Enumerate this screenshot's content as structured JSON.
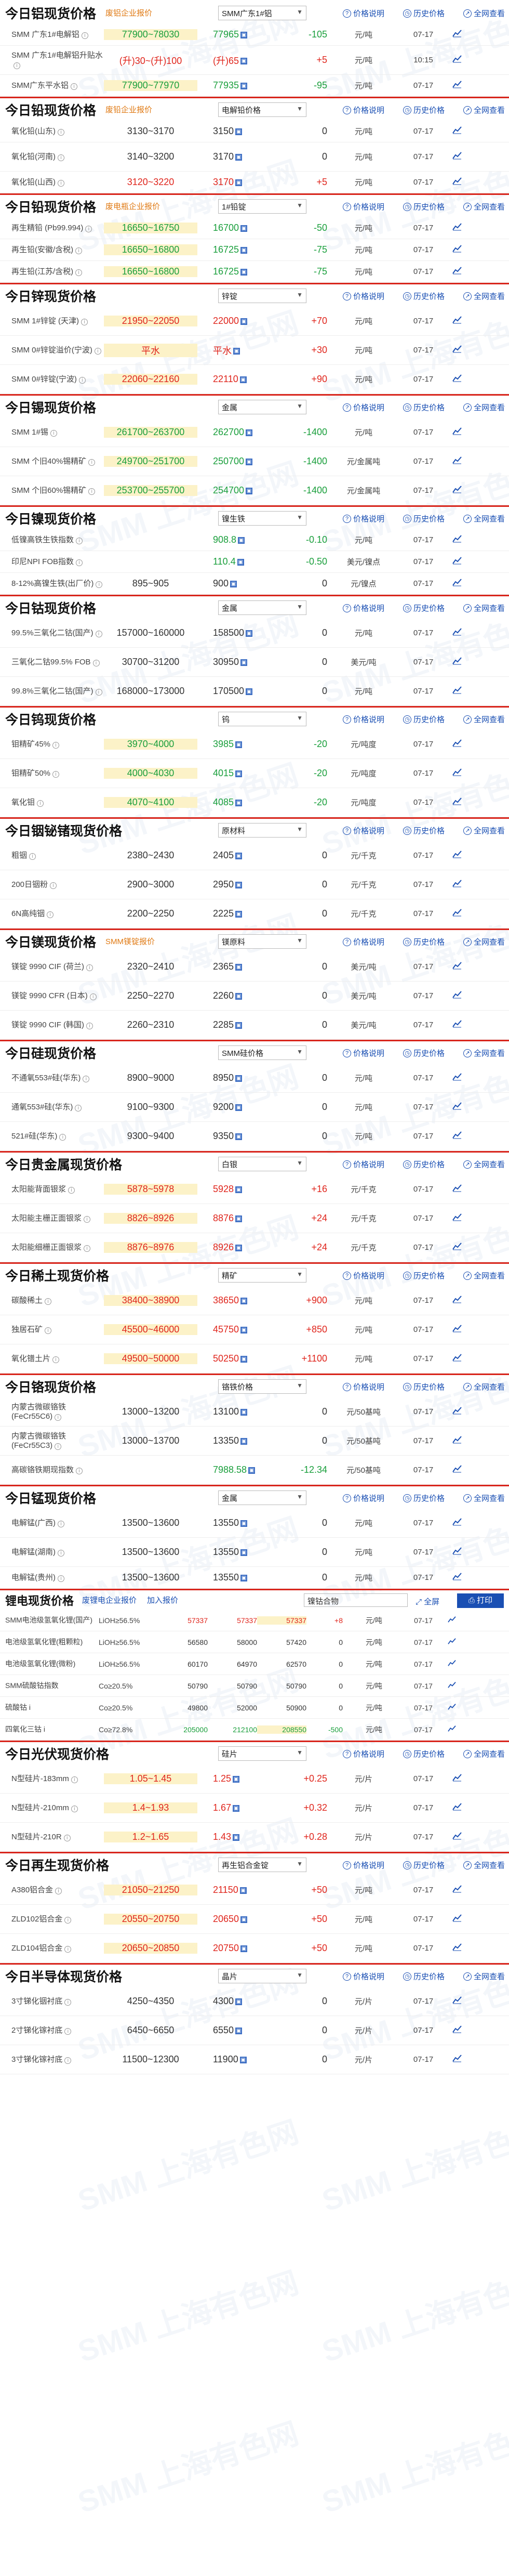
{
  "watermark": "SMM 上海有色网",
  "links": {
    "price_desc": "价格说明",
    "history": "历史价格",
    "full": "全网查看"
  },
  "chart_icon": "line-chart-icon",
  "sections": [
    {
      "title": "今日铝现货价格",
      "tag": "废铝企业报价",
      "select": "SMM广东1#铝",
      "noline": true,
      "rows": [
        {
          "name": "SMM 广东1#电解铝",
          "range": "77900~78030",
          "avg": "77965",
          "chg": "-105",
          "dir": "down",
          "unit": "元/吨",
          "date": "07-17",
          "hl": true
        },
        {
          "name": "SMM 广东1#电解铝升贴水",
          "range": "(升)30~(升)100",
          "avg": "(升)65",
          "chg": "+5",
          "dir": "up",
          "unit": "元/吨",
          "date": "10:15",
          "tall": true
        },
        {
          "name": "SMM广东平水铝",
          "range": "77900~77970",
          "avg": "77935",
          "chg": "-95",
          "dir": "down",
          "unit": "元/吨",
          "date": "07-17",
          "hl": true
        }
      ]
    },
    {
      "title": "今日铅现货价格",
      "tag": "废铅企业报价",
      "select": "电解铅价格",
      "rows": [
        {
          "name": "氧化铅(山东)",
          "range": "3130~3170",
          "avg": "3150",
          "chg": "0",
          "dir": "flat",
          "unit": "元/吨",
          "date": "07-17"
        },
        {
          "name": "氧化铅(河南)",
          "range": "3140~3200",
          "avg": "3170",
          "chg": "0",
          "dir": "flat",
          "unit": "元/吨",
          "date": "07-17",
          "tall": true
        },
        {
          "name": "氧化铅(山西)",
          "range": "3120~3220",
          "avg": "3170",
          "chg": "+5",
          "dir": "up",
          "unit": "元/吨",
          "date": "07-17"
        }
      ]
    },
    {
      "title": "今日铅现货价格",
      "tag": "废电瓶企业报价",
      "select": "1#铅锭",
      "rows": [
        {
          "name": "再生精铅 (Pb99.994)",
          "range": "16650~16750",
          "avg": "16700",
          "chg": "-50",
          "dir": "down",
          "unit": "元/吨",
          "date": "07-17",
          "hl": true
        },
        {
          "name": "再生铅(安徽/含税)",
          "range": "16650~16800",
          "avg": "16725",
          "chg": "-75",
          "dir": "down",
          "unit": "元/吨",
          "date": "07-17",
          "hl": true
        },
        {
          "name": "再生铅(江苏/含税)",
          "range": "16650~16800",
          "avg": "16725",
          "chg": "-75",
          "dir": "down",
          "unit": "元/吨",
          "date": "07-17",
          "hl": true
        }
      ]
    },
    {
      "title": "今日锌现货价格",
      "tag": "",
      "select": "锌锭",
      "rows": [
        {
          "name": "SMM 1#锌锭 (天津)",
          "range": "21950~22050",
          "avg": "22000",
          "chg": "+70",
          "dir": "up",
          "unit": "元/吨",
          "date": "07-17",
          "hl": true,
          "tall": true
        },
        {
          "name": "SMM 0#锌锭溢价(宁波)",
          "range": "平水",
          "avg": "平水",
          "chg": "+30",
          "dir": "up",
          "unit": "元/吨",
          "date": "07-17",
          "hl": true,
          "tall": true
        },
        {
          "name": "SMM 0#锌锭(宁波)",
          "range": "22060~22160",
          "avg": "22110",
          "chg": "+90",
          "dir": "up",
          "unit": "元/吨",
          "date": "07-17",
          "hl": true,
          "tall": true
        }
      ]
    },
    {
      "title": "今日锡现货价格",
      "tag": "",
      "select": "金属",
      "rows": [
        {
          "name": "SMM 1#锡",
          "range": "261700~263700",
          "avg": "262700",
          "chg": "-1400",
          "dir": "down",
          "unit": "元/吨",
          "date": "07-17",
          "hl": true,
          "tall": true
        },
        {
          "name": "SMM 个旧40%锡精矿",
          "range": "249700~251700",
          "avg": "250700",
          "chg": "-1400",
          "dir": "down",
          "unit": "元/金属吨",
          "date": "07-17",
          "hl": true,
          "tall": true
        },
        {
          "name": "SMM 个旧60%锡精矿",
          "range": "253700~255700",
          "avg": "254700",
          "chg": "-1400",
          "dir": "down",
          "unit": "元/金属吨",
          "date": "07-17",
          "hl": true,
          "tall": true
        }
      ]
    },
    {
      "title": "今日镍现货价格",
      "tag": "",
      "select": "镍生铁",
      "rows": [
        {
          "name": "低镍高铁生铁指数",
          "range": "",
          "avg": "908.8",
          "chg": "-0.10",
          "dir": "down",
          "unit": "元/吨",
          "date": "07-17"
        },
        {
          "name": "印尼NPI FOB指数",
          "range": "",
          "avg": "110.4",
          "chg": "-0.50",
          "dir": "down",
          "unit": "美元/镍点",
          "date": "07-17"
        },
        {
          "name": "8-12%高镍生铁(出厂价)",
          "range": "895~905",
          "avg": "900",
          "chg": "0",
          "dir": "flat",
          "unit": "元/镍点",
          "date": "07-17"
        }
      ]
    },
    {
      "title": "今日钴现货价格",
      "tag": "",
      "select": "金属",
      "rows": [
        {
          "name": "99.5%三氧化二钴(国产)",
          "range": "157000~160000",
          "avg": "158500",
          "chg": "0",
          "dir": "flat",
          "unit": "元/吨",
          "date": "07-17",
          "tall": true
        },
        {
          "name": "三氧化二钴99.5% FOB",
          "range": "30700~31200",
          "avg": "30950",
          "chg": "0",
          "dir": "flat",
          "unit": "美元/吨",
          "date": "07-17",
          "tall": true
        },
        {
          "name": "99.8%三氧化二钴(国产)",
          "range": "168000~173000",
          "avg": "170500",
          "chg": "0",
          "dir": "flat",
          "unit": "元/吨",
          "date": "07-17",
          "tall": true
        }
      ]
    },
    {
      "title": "今日钨现货价格",
      "tag": "",
      "select": "钨",
      "rows": [
        {
          "name": "钼精矿45%",
          "range": "3970~4000",
          "avg": "3985",
          "chg": "-20",
          "dir": "down",
          "unit": "元/吨度",
          "date": "07-17",
          "hl": true,
          "tall": true
        },
        {
          "name": "钼精矿50%",
          "range": "4000~4030",
          "avg": "4015",
          "chg": "-20",
          "dir": "down",
          "unit": "元/吨度",
          "date": "07-17",
          "hl": true,
          "tall": true
        },
        {
          "name": "氧化钼",
          "range": "4070~4100",
          "avg": "4085",
          "chg": "-20",
          "dir": "down",
          "unit": "元/吨度",
          "date": "07-17",
          "hl": true,
          "tall": true
        }
      ]
    },
    {
      "title": "今日铟铋锗现货价格",
      "tag": "",
      "select": "原材料",
      "rows": [
        {
          "name": "粗铟",
          "range": "2380~2430",
          "avg": "2405",
          "chg": "0",
          "dir": "flat",
          "unit": "元/千克",
          "date": "07-17",
          "tall": true
        },
        {
          "name": "200日铟粉",
          "range": "2900~3000",
          "avg": "2950",
          "chg": "0",
          "dir": "flat",
          "unit": "元/千克",
          "date": "07-17",
          "tall": true
        },
        {
          "name": "6N高纯铟",
          "range": "2200~2250",
          "avg": "2225",
          "chg": "0",
          "dir": "flat",
          "unit": "元/千克",
          "date": "07-17",
          "tall": true
        }
      ]
    },
    {
      "title": "今日镁现货价格",
      "tag": "SMM镁锭报价",
      "select": "镁原料",
      "rows": [
        {
          "name": "镁锭 9990 CIF (荷兰)",
          "range": "2320~2410",
          "avg": "2365",
          "chg": "0",
          "dir": "flat",
          "unit": "美元/吨",
          "date": "07-17",
          "tall": true
        },
        {
          "name": "镁锭 9990 CFR (日本)",
          "range": "2250~2270",
          "avg": "2260",
          "chg": "0",
          "dir": "flat",
          "unit": "美元/吨",
          "date": "07-17",
          "tall": true
        },
        {
          "name": "镁锭 9990 CIF (韩国)",
          "range": "2260~2310",
          "avg": "2285",
          "chg": "0",
          "dir": "flat",
          "unit": "美元/吨",
          "date": "07-17",
          "tall": true
        }
      ]
    },
    {
      "title": "今日硅现货价格",
      "tag": "",
      "select": "SMM硅价格",
      "rows": [
        {
          "name": "不通氧553#硅(华东)",
          "range": "8900~9000",
          "avg": "8950",
          "chg": "0",
          "dir": "flat",
          "unit": "元/吨",
          "date": "07-17",
          "tall": true
        },
        {
          "name": "通氧553#硅(华东)",
          "range": "9100~9300",
          "avg": "9200",
          "chg": "0",
          "dir": "flat",
          "unit": "元/吨",
          "date": "07-17",
          "tall": true
        },
        {
          "name": "521#硅(华东)",
          "range": "9300~9400",
          "avg": "9350",
          "chg": "0",
          "dir": "flat",
          "unit": "元/吨",
          "date": "07-17",
          "tall": true
        }
      ]
    },
    {
      "title": "今日贵金属现货价格",
      "tag": "",
      "select": "白银",
      "rows": [
        {
          "name": "太阳能背面银浆",
          "range": "5878~5978",
          "avg": "5928",
          "chg": "+16",
          "dir": "up",
          "unit": "元/千克",
          "date": "07-17",
          "hl": true,
          "tall": true
        },
        {
          "name": "太阳能主栅正面银浆",
          "range": "8826~8926",
          "avg": "8876",
          "chg": "+24",
          "dir": "up",
          "unit": "元/千克",
          "date": "07-17",
          "hl": true,
          "tall": true
        },
        {
          "name": "太阳能细栅正面银浆",
          "range": "8876~8976",
          "avg": "8926",
          "chg": "+24",
          "dir": "up",
          "unit": "元/千克",
          "date": "07-17",
          "hl": true,
          "tall": true
        }
      ]
    },
    {
      "title": "今日稀土现货价格",
      "tag": "",
      "select": "精矿",
      "rows": [
        {
          "name": "碳酸稀土",
          "range": "38400~38900",
          "avg": "38650",
          "chg": "+900",
          "dir": "up",
          "unit": "元/吨",
          "date": "07-17",
          "hl": true,
          "tall": true
        },
        {
          "name": "独居石矿",
          "range": "45500~46000",
          "avg": "45750",
          "chg": "+850",
          "dir": "up",
          "unit": "元/吨",
          "date": "07-17",
          "hl": true,
          "tall": true
        },
        {
          "name": "氧化镨土片",
          "range": "49500~50000",
          "avg": "50250",
          "chg": "+1100",
          "dir": "up",
          "unit": "元/吨",
          "date": "07-17",
          "hl": true,
          "tall": true
        }
      ]
    },
    {
      "title": "今日铬现货价格",
      "tag": "",
      "select": "铬铁价格",
      "rows": [
        {
          "name": "内蒙古微碳铬铁 (FeCr55C6)",
          "range": "13000~13200",
          "avg": "13100",
          "chg": "0",
          "dir": "flat",
          "unit": "元/50基吨",
          "date": "07-17",
          "tall": true
        },
        {
          "name": "内蒙古微碳铬铁 (FeCr55C3)",
          "range": "13000~13700",
          "avg": "13350",
          "chg": "0",
          "dir": "flat",
          "unit": "元/50基吨",
          "date": "07-17",
          "tall": true
        },
        {
          "name": "高碳铬铁期现指数",
          "range": "",
          "avg": "7988.58",
          "chg": "-12.34",
          "dir": "down",
          "unit": "元/50基吨",
          "date": "07-17",
          "hl": true,
          "tall": true
        }
      ]
    },
    {
      "title": "今日锰现货价格",
      "tag": "",
      "select": "金属",
      "rows": [
        {
          "name": "电解锰(广西)",
          "range": "13500~13600",
          "avg": "13550",
          "chg": "0",
          "dir": "flat",
          "unit": "元/吨",
          "date": "07-17",
          "tall": true
        },
        {
          "name": "电解锰(湖南)",
          "range": "13500~13600",
          "avg": "13550",
          "chg": "0",
          "dir": "flat",
          "unit": "元/吨",
          "date": "07-17",
          "tall": true
        },
        {
          "name": "电解锰(贵州)",
          "range": "13500~13600",
          "avg": "13550",
          "chg": "0",
          "dir": "flat",
          "unit": "元/吨",
          "date": "07-17"
        }
      ]
    }
  ],
  "lithium": {
    "title": "锂电现货价格",
    "link1": "废锂电企业报价",
    "link2": "加入报价",
    "select": "镍钴合物",
    "full": "全屏",
    "print": "打印",
    "rows": [
      {
        "name": "SMM电池级氢氧化锂(国产)",
        "spec": "LiOH≥56.5%",
        "v1": "57337",
        "v2": "57337",
        "v3": "57337",
        "chg": "+8",
        "dir": "up",
        "unit": "元/吨",
        "date": "07-17",
        "hl": true
      },
      {
        "name": "电池级氢氧化锂(粗颗粒)",
        "spec": "LiOH≥56.5%",
        "v1": "56580",
        "v2": "58000",
        "v3": "57420",
        "chg": "0",
        "dir": "flat",
        "unit": "元/吨",
        "date": "07-17"
      },
      {
        "name": "电池级氢氧化锂(微粉)",
        "spec": "LiOH≥56.5%",
        "v1": "60170",
        "v2": "64970",
        "v3": "62570",
        "chg": "0",
        "dir": "flat",
        "unit": "元/吨",
        "date": "07-17"
      },
      {
        "name": "SMM硫酸钴指数",
        "spec": "Co≥20.5%",
        "v1": "50790",
        "v2": "50790",
        "v3": "50790",
        "chg": "0",
        "dir": "flat",
        "unit": "元/吨",
        "date": "07-17"
      },
      {
        "name": "硫酸钴 i",
        "spec": "Co≥20.5%",
        "v1": "49800",
        "v2": "52000",
        "v3": "50900",
        "chg": "0",
        "dir": "flat",
        "unit": "元/吨",
        "date": "07-17"
      },
      {
        "name": "四氧化三钴 i",
        "spec": "Co≥72.8%",
        "v1": "205000",
        "v2": "212100",
        "v3": "208550",
        "chg": "-500",
        "dir": "down",
        "unit": "元/吨",
        "date": "07-17",
        "hl": true
      }
    ]
  },
  "sections2": [
    {
      "title": "今日光伏现货价格",
      "tag": "",
      "select": "硅片",
      "rows": [
        {
          "name": "N型硅片-183mm",
          "range": "1.05~1.45",
          "avg": "1.25",
          "chg": "+0.25",
          "dir": "up",
          "unit": "元/片",
          "date": "07-17",
          "hl": true,
          "tall": true
        },
        {
          "name": "N型硅片-210mm",
          "range": "1.4~1.93",
          "avg": "1.67",
          "chg": "+0.32",
          "dir": "up",
          "unit": "元/片",
          "date": "07-17",
          "hl": true,
          "tall": true
        },
        {
          "name": "N型硅片-210R",
          "range": "1.2~1.65",
          "avg": "1.43",
          "chg": "+0.28",
          "dir": "up",
          "unit": "元/片",
          "date": "07-17",
          "hl": true,
          "tall": true
        }
      ]
    },
    {
      "title": "今日再生现货价格",
      "tag": "",
      "select": "再生铝合金锭",
      "rows": [
        {
          "name": "A380铝合金",
          "range": "21050~21250",
          "avg": "21150",
          "chg": "+50",
          "dir": "up",
          "unit": "元/吨",
          "date": "07-17",
          "hl": true,
          "tall": true
        },
        {
          "name": "ZLD102铝合金",
          "range": "20550~20750",
          "avg": "20650",
          "chg": "+50",
          "dir": "up",
          "unit": "元/吨",
          "date": "07-17",
          "hl": true,
          "tall": true
        },
        {
          "name": "ZLD104铝合金",
          "range": "20650~20850",
          "avg": "20750",
          "chg": "+50",
          "dir": "up",
          "unit": "元/吨",
          "date": "07-17",
          "hl": true,
          "tall": true
        }
      ]
    },
    {
      "title": "今日半导体现货价格",
      "tag": "",
      "select": "晶片",
      "rows": [
        {
          "name": "3寸锑化铟衬底",
          "range": "4250~4350",
          "avg": "4300",
          "chg": "0",
          "dir": "flat",
          "unit": "元/片",
          "date": "07-17",
          "tall": true
        },
        {
          "name": "2寸锑化镓衬底",
          "range": "6450~6650",
          "avg": "6550",
          "chg": "0",
          "dir": "flat",
          "unit": "元/片",
          "date": "07-17",
          "tall": true
        },
        {
          "name": "3寸锑化镓衬底",
          "range": "11500~12300",
          "avg": "11900",
          "chg": "0",
          "dir": "flat",
          "unit": "元/片",
          "date": "07-17",
          "tall": true
        }
      ]
    }
  ]
}
